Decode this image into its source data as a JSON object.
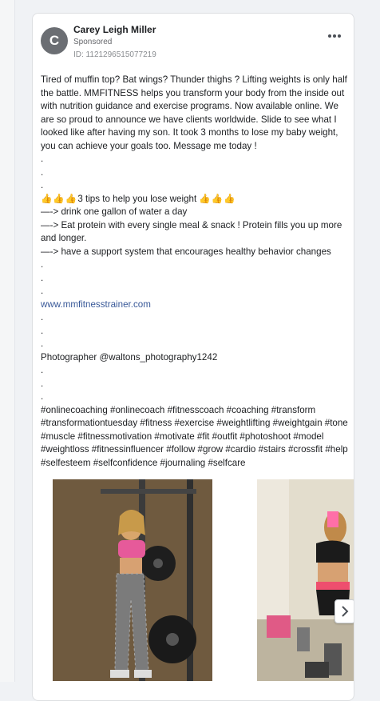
{
  "post": {
    "author": "Carey Leigh Miller",
    "avatar_letter": "C",
    "sponsored": "Sponsored",
    "id_label": "ID: 1121296515077219",
    "paragraph1": "Tired of muffin top? Bat wings? Thunder thighs ? Lifting weights is only half the battle. MMFITNESS helps you transform your body from the inside out with nutrition guidance and exercise programs. Now available online. We are so proud to announce we have clients worldwide. Slide to see what I looked like after having my son. It took 3 months to lose my baby weight, you can achieve your goals too. Message me today !",
    "dot": ".",
    "emoji": "👍👍👍",
    "tips_title": "3 tips to help you lose weight ",
    "tip1": "—-> drink one gallon of water a day",
    "tip2": "—-> Eat protein with every single meal & snack ! Protein fills you up more and longer.",
    "tip3": "—-> have a support system that encourages healthy behavior changes",
    "link": "www.mmfitnesstrainer.com",
    "photographer": "Photographer @waltons_photography1242",
    "hashtags": "#onlinecoaching #onlinecoach #fitnesscoach #coaching #transform #transformationtuesday #fitness #exercise #weightlifting #weightgain #tone #muscle #fitnessmotivation #motivate #fit #outfit #photoshoot #model #weightloss #fitnessinfluencer #follow #grow #cardio #stairs #crossfit #help #selfesteem #selfconfidence #journaling #selfcare"
  },
  "icons": {
    "more": "more-horizontal-icon",
    "next": "chevron-right-icon"
  }
}
